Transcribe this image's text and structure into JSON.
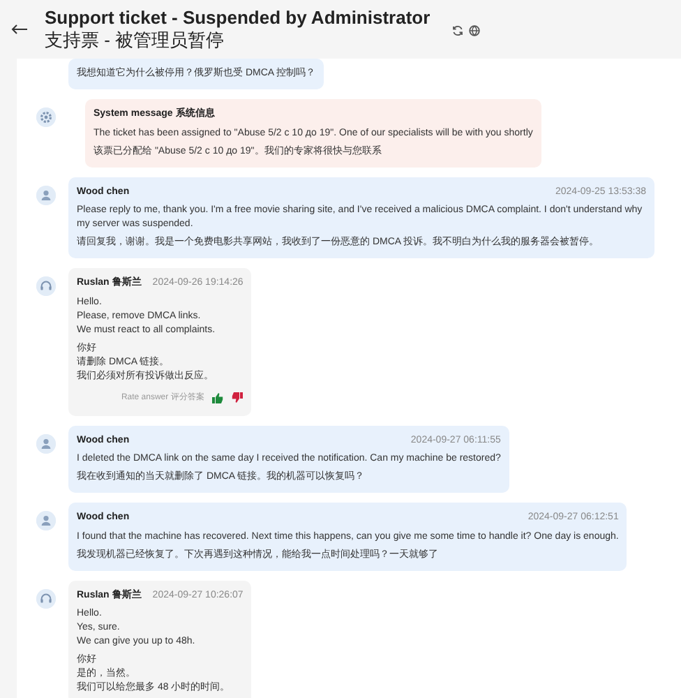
{
  "header": {
    "title": "Support ticket - Suspended by Administrator",
    "subtitle": "支持票 - 被管理员暂停"
  },
  "messages": [
    {
      "kind": "customer",
      "continued": true,
      "paragraphs": [
        [
          "我想知道它为什么被停用？俄罗斯也受 DMCA 控制吗？"
        ]
      ]
    },
    {
      "kind": "system",
      "continued": false,
      "title": "System message 系统信息",
      "paragraphs": [
        [
          "The ticket has been assigned to \"Abuse 5/2 с 10 до 19\". One of our specialists will be with you shortly"
        ],
        [
          "该票已分配给 \"Abuse 5/2 с 10 до 19\"。我们的专家将很快与您联系"
        ]
      ]
    },
    {
      "kind": "customer",
      "continued": false,
      "author": "Wood chen",
      "time": "2024-09-25 13:53:38",
      "paragraphs": [
        [
          "Please reply to me, thank you. I'm a free movie sharing site, and I've received a malicious DMCA complaint. I don't understand why my server was suspended."
        ],
        [
          "请回复我，谢谢。我是一个免费电影共享网站，我收到了一份恶意的 DMCA 投诉。我不明白为什么我的服务器会被暂停。"
        ]
      ]
    },
    {
      "kind": "agent",
      "continued": false,
      "author": "Ruslan 鲁斯兰",
      "time": "2024-09-26 19:14:26",
      "paragraphs": [
        [
          "Hello.",
          "Please, remove DMCA links.",
          "We must react to all complaints."
        ],
        [
          "你好",
          "请删除 DMCA 链接。",
          "我们必须对所有投诉做出反应。"
        ]
      ],
      "rating": "Rate answer 评分答案"
    },
    {
      "kind": "customer",
      "continued": false,
      "author": "Wood chen",
      "time": "2024-09-27 06:11:55",
      "paragraphs": [
        [
          "I deleted the DMCA link on the same day I received the notification. Can my machine be restored?"
        ],
        [
          "我在收到通知的当天就删除了 DMCA 链接。我的机器可以恢复吗？"
        ]
      ]
    },
    {
      "kind": "customer",
      "continued": false,
      "author": "Wood chen",
      "time": "2024-09-27 06:12:51",
      "paragraphs": [
        [
          "I found that the machine has recovered. Next time this happens, can you give me some time to handle it? One day is enough."
        ],
        [
          "我发现机器已经恢复了。下次再遇到这种情况，能给我一点时间处理吗？一天就够了"
        ]
      ]
    },
    {
      "kind": "agent",
      "continued": false,
      "author": "Ruslan 鲁斯兰",
      "time": "2024-09-27 10:26:07",
      "paragraphs": [
        [
          "Hello.",
          "Yes, sure.",
          "We can give you up to 48h."
        ],
        [
          "你好",
          "是的，当然。",
          "我们可以给您最多 48 小时的时间。"
        ]
      ]
    }
  ]
}
